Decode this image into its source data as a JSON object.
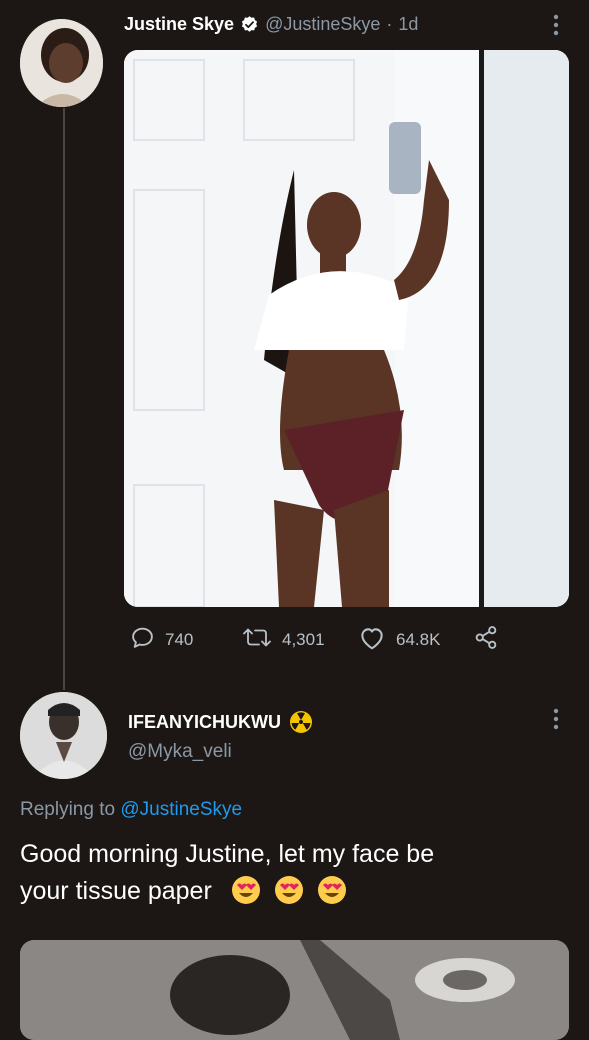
{
  "tweet1": {
    "author_name": "Justine Skye",
    "handle": "@JustineSkye",
    "separator": "·",
    "time": "1d",
    "stats": {
      "replies": "740",
      "retweets": "4,301",
      "likes": "64.8K"
    }
  },
  "tweet2": {
    "author_name": "IFEANYICHUKWU",
    "handle": "@Myka_veli",
    "replying_prefix": "Replying to",
    "replying_handle": "@JustineSkye",
    "text_line1": "Good morning Justine, let my face be",
    "text_line2": "your tissue paper"
  },
  "colors": {
    "background": "#1c1714",
    "link": "#1d9bf0",
    "verified": "#ffffff",
    "muted": "#8b98a5"
  }
}
